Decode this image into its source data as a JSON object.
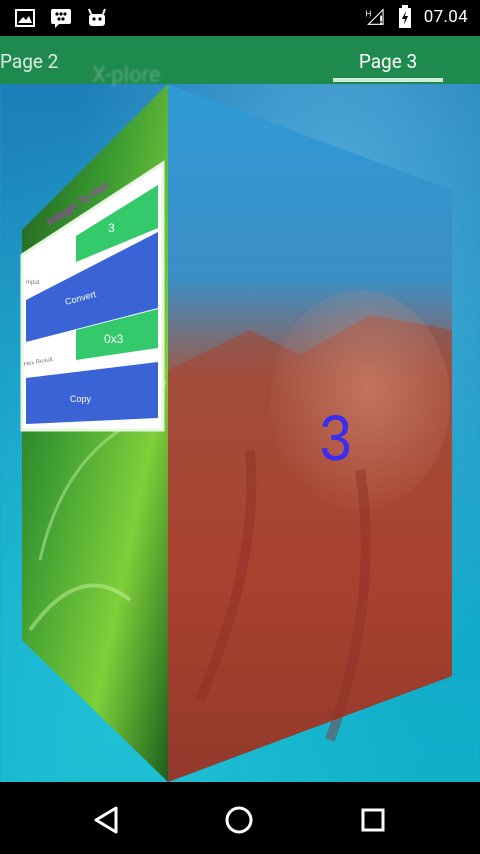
{
  "statusbar": {
    "time": "07.04",
    "icons": [
      "gallery-icon",
      "bbm-icon",
      "android-icon",
      "signal-h-icon",
      "battery-charging-icon"
    ]
  },
  "tabs": [
    {
      "label": "Page 2",
      "selected": false
    },
    {
      "label": "Page 3",
      "selected": true
    }
  ],
  "background_title": "X-plore",
  "left_face": {
    "app_title": "Integer To Hex",
    "input_value": "3",
    "input_label": "Input",
    "convert_label": "Convert",
    "result_label": "Hex Result",
    "result_value": "0x3",
    "copy_label": "Copy"
  },
  "right_face": {
    "page_number": "3"
  },
  "navbar": {
    "buttons": [
      "back-icon",
      "home-icon",
      "recents-icon"
    ]
  },
  "colors": {
    "statusbar": "#000000",
    "tabstrip": "#1f8a4e",
    "green_button": "#34c96a",
    "blue_button": "#3a63d6",
    "page_number": "#3a2cf0"
  }
}
